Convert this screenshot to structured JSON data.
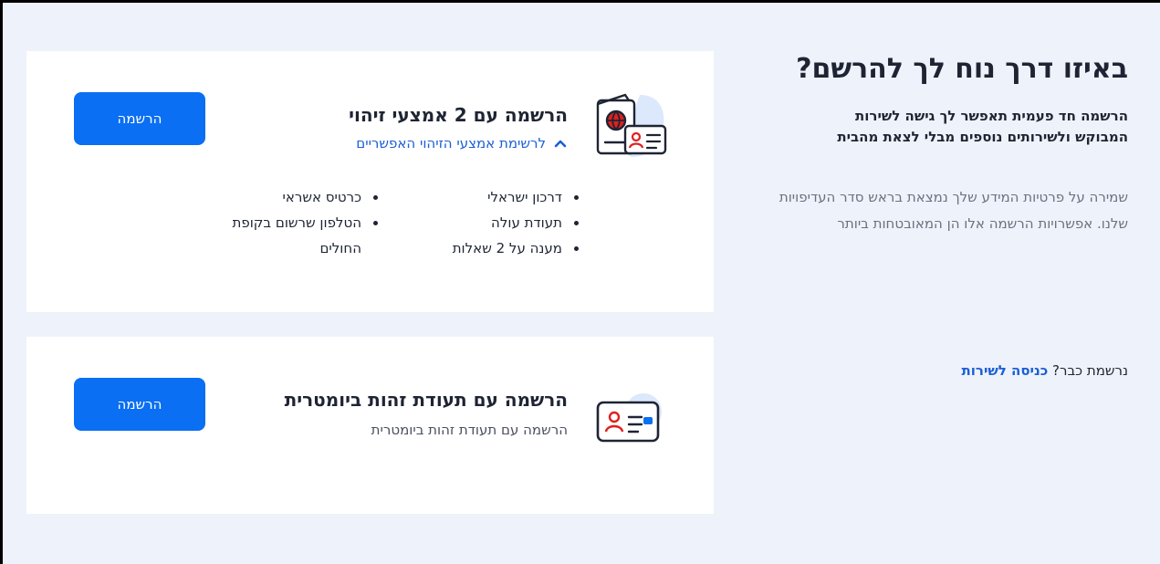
{
  "colors": {
    "page_bg": "#eef2fa",
    "primary_button": "#0a6ff2",
    "link": "#1a5fd6",
    "text": "#1e2433",
    "muted_text": "#6b7180"
  },
  "intro_section": {
    "heading": "באיזו דרך נוח לך להרשם?",
    "description": "הרשמה חד פעמית תאפשר לך גישה לשירות המבוקש ולשירותים נוספים מבלי לצאת מהבית",
    "privacy_note": "שמירה על פרטיות המידע שלך נמצאת בראש סדר העדיפויות שלנו. אפשרויות הרשמה אלו הן המאובטחות ביותר",
    "already_registered_text": "נרשמת כבר?",
    "login_link": "כניסה לשירות"
  },
  "option_two_ids": {
    "icon": "passport-and-id-card-icon",
    "title": "הרשמה עם 2 אמצעי זיהוי",
    "toggle_label": "לרשימת אמצעי הזיהוי האפשריים",
    "toggle_icon": "chevron-up-icon",
    "button_label": "הרשמה",
    "id_methods": [
      "דרכון ישראלי",
      "כרטיס אשראי",
      "תעודת עולה",
      "הטלפון שרשום בקופת",
      "מענה על 2 שאלות",
      "החולים"
    ]
  },
  "option_biometric": {
    "icon": "biometric-id-card-icon",
    "title": "הרשמה עם תעודת זהות ביומטרית",
    "subtitle": "הרשמה עם תעודת זהות ביומטרית",
    "button_label": "הרשמה"
  }
}
